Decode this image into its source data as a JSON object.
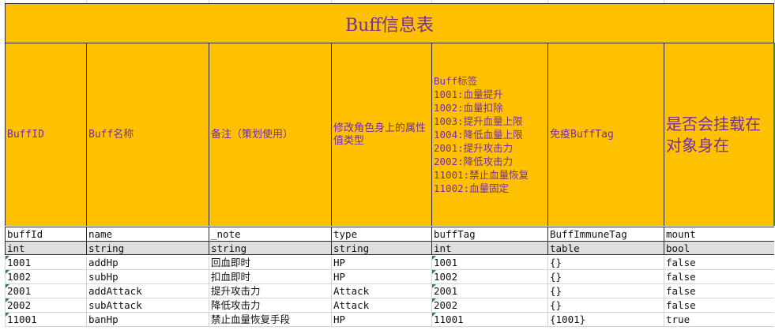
{
  "title": "Buff信息表",
  "header_cells": [
    "BuffID",
    "Buff名称",
    "备注（策划使用）",
    "修改角色身上的属性值类型",
    [
      "Buff标签",
      "1001:血量提升",
      "1002:血量扣除",
      "1003:提升血量上限",
      "1004:降低血量上限",
      "2001:提升攻击力",
      "2002:降低攻击力",
      "11001:禁止血量恢复",
      "11002:血量固定"
    ],
    "免疫BuffTag",
    "是否会挂载在对象身在"
  ],
  "field_names": [
    "buffId",
    "name",
    "_note",
    "type",
    "buffTag",
    "BuffImmuneTag",
    "mount"
  ],
  "field_types": [
    "int",
    "string",
    "string",
    "string",
    "int",
    "table",
    "bool"
  ],
  "rows": [
    [
      "1001",
      "addHp",
      "回血即时",
      "HP",
      "1001",
      "{}",
      "false"
    ],
    [
      "1002",
      "subHp",
      "扣血即时",
      "HP",
      "1002",
      "{}",
      "false"
    ],
    [
      "2001",
      "addAttack",
      "提升攻击力",
      "Attack",
      "2001",
      "{}",
      "false"
    ],
    [
      "2002",
      "subAttack",
      "降低攻击力",
      "Attack",
      "2002",
      "{}",
      "false"
    ],
    [
      "11001",
      "banHp",
      "禁止血量恢复手段",
      "HP",
      "11001",
      "{1001}",
      "true"
    ]
  ],
  "colors": {
    "header_fill": "#ffc000",
    "header_text": "#7030a0",
    "type_row_fill": "#dedede",
    "comment_marker": "#1e8f3c"
  }
}
